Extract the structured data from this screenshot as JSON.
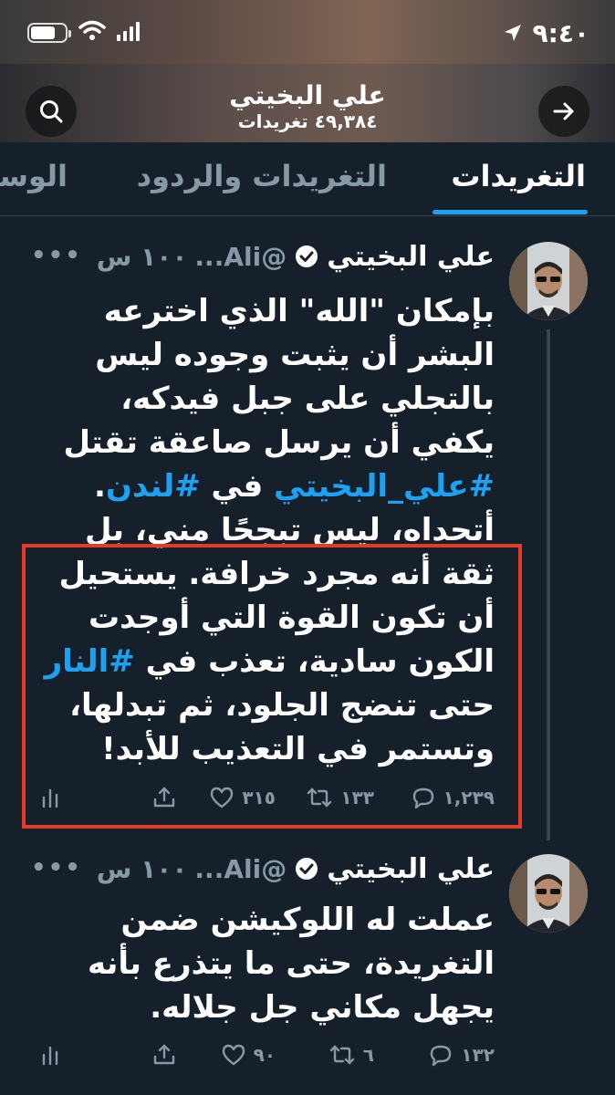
{
  "status_bar": {
    "time": "٩:٤٠"
  },
  "header": {
    "name": "علي البخيتي",
    "tweet_count": "٤٩,٣٨٤ تغريدات"
  },
  "tabs": [
    {
      "label": "التغريدات",
      "active": true
    },
    {
      "label": "التغريدات والردود",
      "active": false
    },
    {
      "label": "الوسائط",
      "active": false
    }
  ],
  "tweets": [
    {
      "name": "علي البخيتي",
      "handle": "...Ali@",
      "time": "١٠٠ س",
      "text_parts": [
        "بإمكان \"الله\" الذي اخترعه البشر أن يثبت وجوده ليس بالتجلي على جبل فيدكه، يكفي أن يرسل صاعقة تقتل ",
        "#علي_البخيتي",
        " في ",
        "#لندن",
        ".",
        "أتحداه، ليس تبجحًا مني، بل ثقة أنه مجرد خرافة. يستحيل أن تكون القوة التي أوجدت الكون سادية، تعذب في ",
        "#النار",
        " حتى تنضج الجلود، ثم تبدلها، وتستمر في التعذيب للأبد!"
      ],
      "replies": "١,٢٣٩",
      "retweets": "١٣٣",
      "likes": "٣١٥"
    },
    {
      "name": "علي البخيتي",
      "handle": "...Ali@",
      "time": "١٠٠ س",
      "text": "عملت له اللوكيشن ضمن التغريدة، حتى ما يتذرع بأنه يجهل مكاني جل جلاله.",
      "replies": "١٣٢",
      "retweets": "٦",
      "likes": "٩٠"
    }
  ],
  "colors": {
    "background": "#15202b",
    "accent": "#1da1f2",
    "muted": "#8899a6",
    "highlight_box": "#e43a2c"
  },
  "icons": [
    "search-icon",
    "forward-arrow-icon",
    "location-icon",
    "battery-icon",
    "wifi-icon",
    "signal-icon",
    "verified-icon",
    "reply-icon",
    "retweet-icon",
    "like-icon",
    "share-icon",
    "analytics-icon",
    "more-icon"
  ]
}
